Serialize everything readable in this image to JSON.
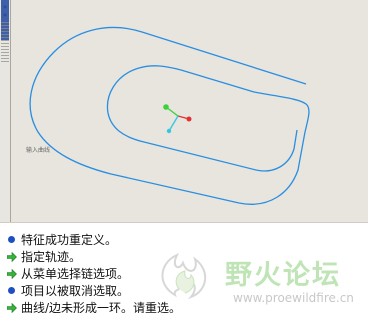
{
  "graphics": {
    "entity_label": "输入曲线",
    "colors": {
      "background": "#e7e5de",
      "curve": "#2a8ee0",
      "csys_x": "#e23030",
      "csys_y": "#3ad23a",
      "csys_z": "#34c8e0"
    }
  },
  "messages": [
    {
      "icon": "info-dot",
      "text": "特征成功重定义。"
    },
    {
      "icon": "prompt-arrow",
      "text": "指定轨迹。"
    },
    {
      "icon": "prompt-arrow",
      "text": "从菜单选择链选项。"
    },
    {
      "icon": "info-dot",
      "text": "项目以被取消选取。"
    },
    {
      "icon": "prompt-arrow",
      "text": "曲线/边未形成一环。请重选。"
    }
  ],
  "watermark": {
    "title": "野火论坛",
    "url": "www.proewildfire.cn"
  }
}
